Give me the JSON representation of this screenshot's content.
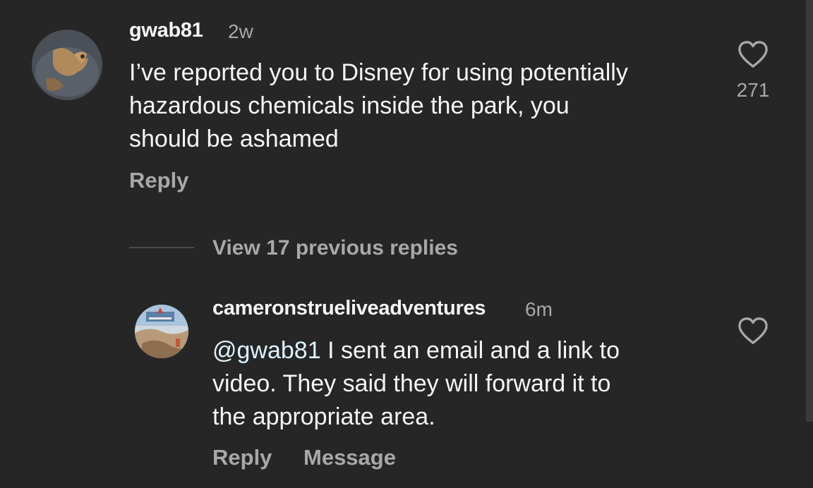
{
  "comments": [
    {
      "username": "gwab81",
      "time": "2w",
      "text_lines": [
        "I’ve reported you to Disney for using potentially",
        "hazardous chemicals inside the park, you",
        "should be ashamed"
      ],
      "likes": "271",
      "reply_label": "Reply"
    }
  ],
  "thread": {
    "view_replies_label": "View 17 previous replies"
  },
  "replies": [
    {
      "username": "cameronstrueliveadventures",
      "time": "6m",
      "mention": "@gwab81",
      "text_lines": [
        " I sent an email and a link to",
        "video. They said they will forward it to",
        "the appropriate area."
      ],
      "reply_label": "Reply",
      "message_label": "Message"
    }
  ],
  "colors": {
    "background": "#262626",
    "primary_text": "#f5f5f5",
    "secondary_text": "#a8a8a8",
    "mention": "#e0f1ff"
  },
  "icons": {
    "like": "heart-outline-icon"
  }
}
